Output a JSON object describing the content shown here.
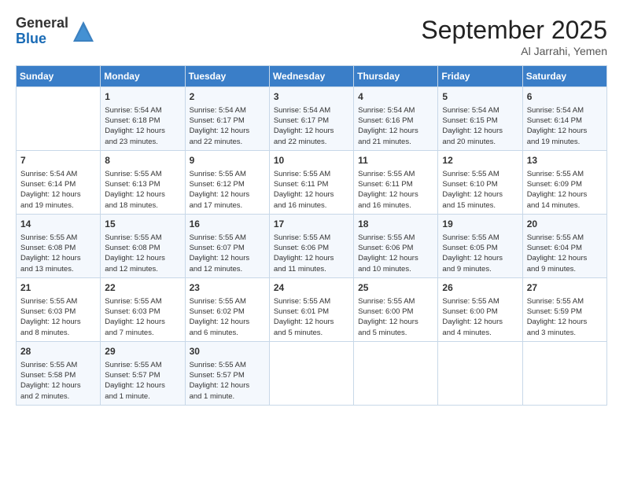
{
  "logo": {
    "general": "General",
    "blue": "Blue"
  },
  "header": {
    "month": "September 2025",
    "location": "Al Jarrahi, Yemen"
  },
  "weekdays": [
    "Sunday",
    "Monday",
    "Tuesday",
    "Wednesday",
    "Thursday",
    "Friday",
    "Saturday"
  ],
  "weeks": [
    [
      {
        "day": "",
        "info": ""
      },
      {
        "day": "1",
        "info": "Sunrise: 5:54 AM\nSunset: 6:18 PM\nDaylight: 12 hours\nand 23 minutes."
      },
      {
        "day": "2",
        "info": "Sunrise: 5:54 AM\nSunset: 6:17 PM\nDaylight: 12 hours\nand 22 minutes."
      },
      {
        "day": "3",
        "info": "Sunrise: 5:54 AM\nSunset: 6:17 PM\nDaylight: 12 hours\nand 22 minutes."
      },
      {
        "day": "4",
        "info": "Sunrise: 5:54 AM\nSunset: 6:16 PM\nDaylight: 12 hours\nand 21 minutes."
      },
      {
        "day": "5",
        "info": "Sunrise: 5:54 AM\nSunset: 6:15 PM\nDaylight: 12 hours\nand 20 minutes."
      },
      {
        "day": "6",
        "info": "Sunrise: 5:54 AM\nSunset: 6:14 PM\nDaylight: 12 hours\nand 19 minutes."
      }
    ],
    [
      {
        "day": "7",
        "info": "Sunrise: 5:54 AM\nSunset: 6:14 PM\nDaylight: 12 hours\nand 19 minutes."
      },
      {
        "day": "8",
        "info": "Sunrise: 5:55 AM\nSunset: 6:13 PM\nDaylight: 12 hours\nand 18 minutes."
      },
      {
        "day": "9",
        "info": "Sunrise: 5:55 AM\nSunset: 6:12 PM\nDaylight: 12 hours\nand 17 minutes."
      },
      {
        "day": "10",
        "info": "Sunrise: 5:55 AM\nSunset: 6:11 PM\nDaylight: 12 hours\nand 16 minutes."
      },
      {
        "day": "11",
        "info": "Sunrise: 5:55 AM\nSunset: 6:11 PM\nDaylight: 12 hours\nand 16 minutes."
      },
      {
        "day": "12",
        "info": "Sunrise: 5:55 AM\nSunset: 6:10 PM\nDaylight: 12 hours\nand 15 minutes."
      },
      {
        "day": "13",
        "info": "Sunrise: 5:55 AM\nSunset: 6:09 PM\nDaylight: 12 hours\nand 14 minutes."
      }
    ],
    [
      {
        "day": "14",
        "info": "Sunrise: 5:55 AM\nSunset: 6:08 PM\nDaylight: 12 hours\nand 13 minutes."
      },
      {
        "day": "15",
        "info": "Sunrise: 5:55 AM\nSunset: 6:08 PM\nDaylight: 12 hours\nand 12 minutes."
      },
      {
        "day": "16",
        "info": "Sunrise: 5:55 AM\nSunset: 6:07 PM\nDaylight: 12 hours\nand 12 minutes."
      },
      {
        "day": "17",
        "info": "Sunrise: 5:55 AM\nSunset: 6:06 PM\nDaylight: 12 hours\nand 11 minutes."
      },
      {
        "day": "18",
        "info": "Sunrise: 5:55 AM\nSunset: 6:06 PM\nDaylight: 12 hours\nand 10 minutes."
      },
      {
        "day": "19",
        "info": "Sunrise: 5:55 AM\nSunset: 6:05 PM\nDaylight: 12 hours\nand 9 minutes."
      },
      {
        "day": "20",
        "info": "Sunrise: 5:55 AM\nSunset: 6:04 PM\nDaylight: 12 hours\nand 9 minutes."
      }
    ],
    [
      {
        "day": "21",
        "info": "Sunrise: 5:55 AM\nSunset: 6:03 PM\nDaylight: 12 hours\nand 8 minutes."
      },
      {
        "day": "22",
        "info": "Sunrise: 5:55 AM\nSunset: 6:03 PM\nDaylight: 12 hours\nand 7 minutes."
      },
      {
        "day": "23",
        "info": "Sunrise: 5:55 AM\nSunset: 6:02 PM\nDaylight: 12 hours\nand 6 minutes."
      },
      {
        "day": "24",
        "info": "Sunrise: 5:55 AM\nSunset: 6:01 PM\nDaylight: 12 hours\nand 5 minutes."
      },
      {
        "day": "25",
        "info": "Sunrise: 5:55 AM\nSunset: 6:00 PM\nDaylight: 12 hours\nand 5 minutes."
      },
      {
        "day": "26",
        "info": "Sunrise: 5:55 AM\nSunset: 6:00 PM\nDaylight: 12 hours\nand 4 minutes."
      },
      {
        "day": "27",
        "info": "Sunrise: 5:55 AM\nSunset: 5:59 PM\nDaylight: 12 hours\nand 3 minutes."
      }
    ],
    [
      {
        "day": "28",
        "info": "Sunrise: 5:55 AM\nSunset: 5:58 PM\nDaylight: 12 hours\nand 2 minutes."
      },
      {
        "day": "29",
        "info": "Sunrise: 5:55 AM\nSunset: 5:57 PM\nDaylight: 12 hours\nand 1 minute."
      },
      {
        "day": "30",
        "info": "Sunrise: 5:55 AM\nSunset: 5:57 PM\nDaylight: 12 hours\nand 1 minute."
      },
      {
        "day": "",
        "info": ""
      },
      {
        "day": "",
        "info": ""
      },
      {
        "day": "",
        "info": ""
      },
      {
        "day": "",
        "info": ""
      }
    ]
  ]
}
